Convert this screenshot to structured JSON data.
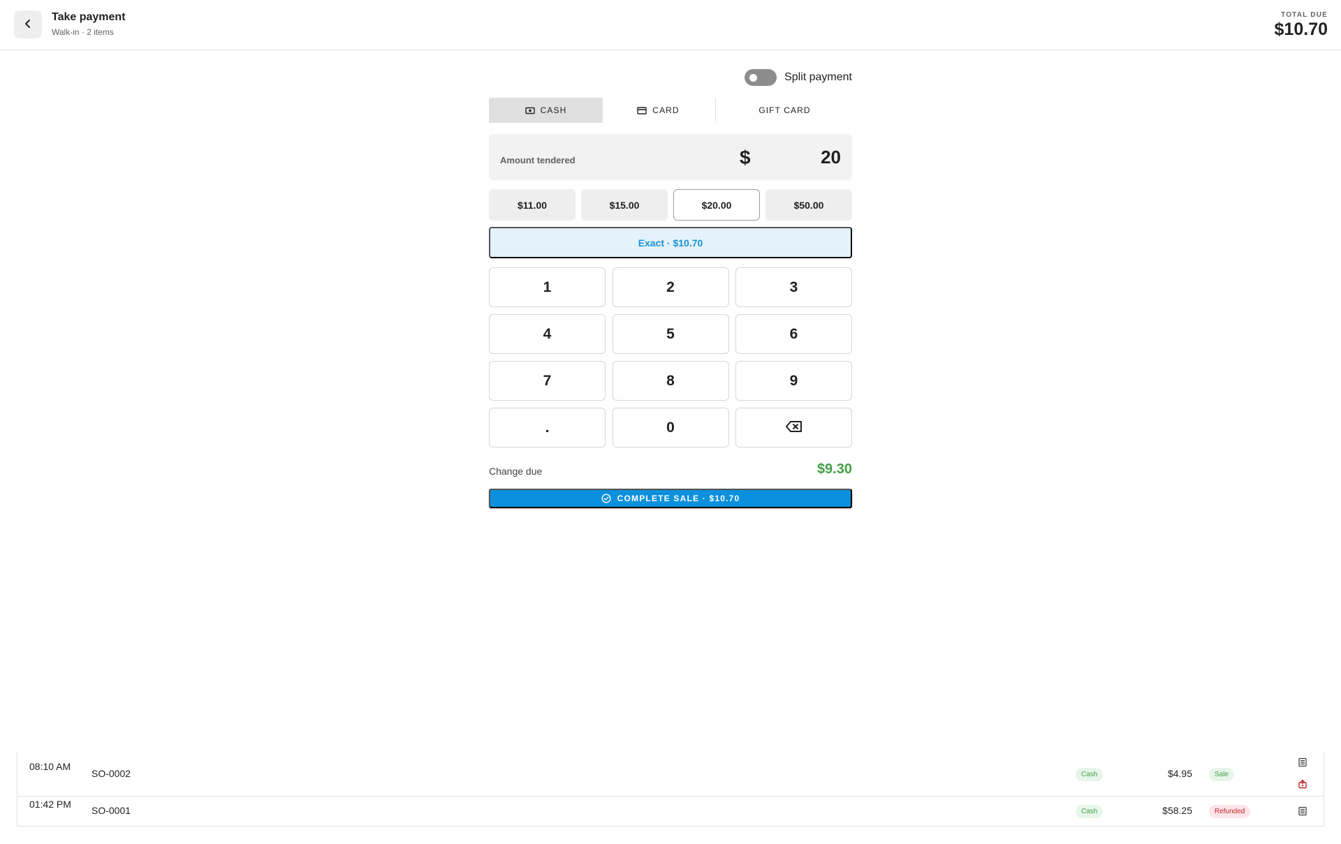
{
  "header": {
    "title": "Take payment",
    "subtitle": "Walk-in · 2 items",
    "total_label": "TOTAL DUE",
    "total_value": "$10.70"
  },
  "split": {
    "label": "Split payment",
    "enabled": false
  },
  "tabs": [
    {
      "label": "CASH",
      "icon": "cash-icon",
      "active": true
    },
    {
      "label": "CARD",
      "icon": "credit-card-icon",
      "active": false
    },
    {
      "label": "GIFT CARD",
      "icon": "",
      "active": false
    }
  ],
  "tender": {
    "label": "Amount tendered",
    "currency": "$",
    "value": "20"
  },
  "quick_amounts": [
    {
      "label": "$11.00",
      "selected": false
    },
    {
      "label": "$15.00",
      "selected": false
    },
    {
      "label": "$20.00",
      "selected": true
    },
    {
      "label": "$50.00",
      "selected": false
    }
  ],
  "exact_label": "Exact · $10.70",
  "keypad": [
    "1",
    "2",
    "3",
    "4",
    "5",
    "6",
    "7",
    "8",
    "9",
    ".",
    "0",
    "backspace-icon"
  ],
  "change": {
    "label": "Change due",
    "value": "$9.30"
  },
  "complete_label": "COMPLETE SALE · $10.70",
  "colors": {
    "primary": "#0a90dc",
    "success": "#43a047",
    "danger": "#c62828",
    "exact_bg": "#e3f2fb"
  },
  "transactions": [
    {
      "time": "08:10 AM",
      "order": "SO-0002",
      "method": "Cash",
      "amount": "$4.95",
      "status": "Sale",
      "icons": [
        "receipt-icon",
        "refund-icon"
      ]
    },
    {
      "time": "01:42 PM",
      "order": "SO-0001",
      "method": "Cash",
      "amount": "$58.25",
      "status": "Refunded",
      "icons": [
        "receipt-icon"
      ]
    }
  ]
}
